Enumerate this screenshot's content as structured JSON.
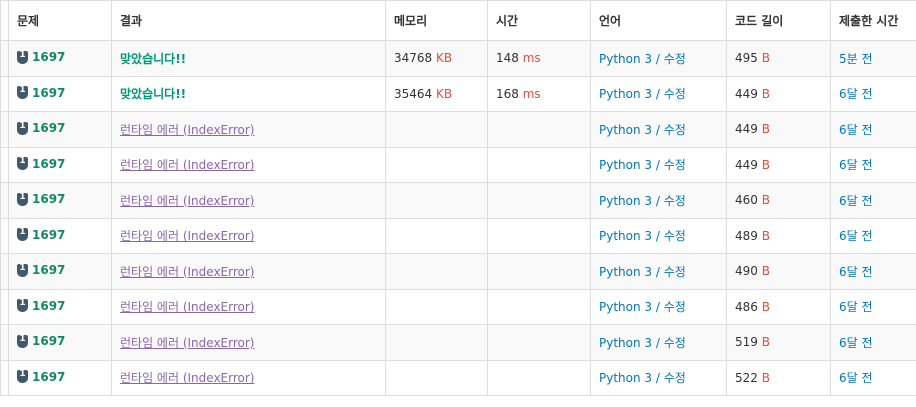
{
  "headers": {
    "problem": "문제",
    "result": "결과",
    "memory": "메모리",
    "time": "시간",
    "language": "언어",
    "code_length": "코드 길이",
    "submitted": "제출한 시간"
  },
  "rows": [
    {
      "problem": "1697",
      "result": "맞았습니다!!",
      "accepted": true,
      "memory": "34768",
      "memory_unit": "KB",
      "time": "148",
      "time_unit": "ms",
      "language": "Python 3 / 수정",
      "length": "495",
      "length_unit": "B",
      "submitted": "5분 전"
    },
    {
      "problem": "1697",
      "result": "맞았습니다!!",
      "accepted": true,
      "memory": "35464",
      "memory_unit": "KB",
      "time": "168",
      "time_unit": "ms",
      "language": "Python 3 / 수정",
      "length": "449",
      "length_unit": "B",
      "submitted": "6달 전"
    },
    {
      "problem": "1697",
      "result": "런타임 에러 (IndexError)",
      "accepted": false,
      "memory": "",
      "memory_unit": "",
      "time": "",
      "time_unit": "",
      "language": "Python 3 / 수정",
      "length": "449",
      "length_unit": "B",
      "submitted": "6달 전"
    },
    {
      "problem": "1697",
      "result": "런타임 에러 (IndexError)",
      "accepted": false,
      "memory": "",
      "memory_unit": "",
      "time": "",
      "time_unit": "",
      "language": "Python 3 / 수정",
      "length": "449",
      "length_unit": "B",
      "submitted": "6달 전"
    },
    {
      "problem": "1697",
      "result": "런타임 에러 (IndexError)",
      "accepted": false,
      "memory": "",
      "memory_unit": "",
      "time": "",
      "time_unit": "",
      "language": "Python 3 / 수정",
      "length": "460",
      "length_unit": "B",
      "submitted": "6달 전"
    },
    {
      "problem": "1697",
      "result": "런타임 에러 (IndexError)",
      "accepted": false,
      "memory": "",
      "memory_unit": "",
      "time": "",
      "time_unit": "",
      "language": "Python 3 / 수정",
      "length": "489",
      "length_unit": "B",
      "submitted": "6달 전"
    },
    {
      "problem": "1697",
      "result": "런타임 에러 (IndexError)",
      "accepted": false,
      "memory": "",
      "memory_unit": "",
      "time": "",
      "time_unit": "",
      "language": "Python 3 / 수정",
      "length": "490",
      "length_unit": "B",
      "submitted": "6달 전"
    },
    {
      "problem": "1697",
      "result": "런타임 에러 (IndexError)",
      "accepted": false,
      "memory": "",
      "memory_unit": "",
      "time": "",
      "time_unit": "",
      "language": "Python 3 / 수정",
      "length": "486",
      "length_unit": "B",
      "submitted": "6달 전"
    },
    {
      "problem": "1697",
      "result": "런타임 에러 (IndexError)",
      "accepted": false,
      "memory": "",
      "memory_unit": "",
      "time": "",
      "time_unit": "",
      "language": "Python 3 / 수정",
      "length": "519",
      "length_unit": "B",
      "submitted": "6달 전"
    },
    {
      "problem": "1697",
      "result": "런타임 에러 (IndexError)",
      "accepted": false,
      "memory": "",
      "memory_unit": "",
      "time": "",
      "time_unit": "",
      "language": "Python 3 / 수정",
      "length": "522",
      "length_unit": "B",
      "submitted": "6달 전"
    }
  ],
  "colors": {
    "accepted": "#009874",
    "runtime_error": "#8b66ad",
    "unit": "#e74c3c",
    "link": "#0076c0",
    "problem": "#0f8a62",
    "tier_badge": "#40596b"
  },
  "icons": {
    "problem_tier": "tier-badge-icon"
  }
}
